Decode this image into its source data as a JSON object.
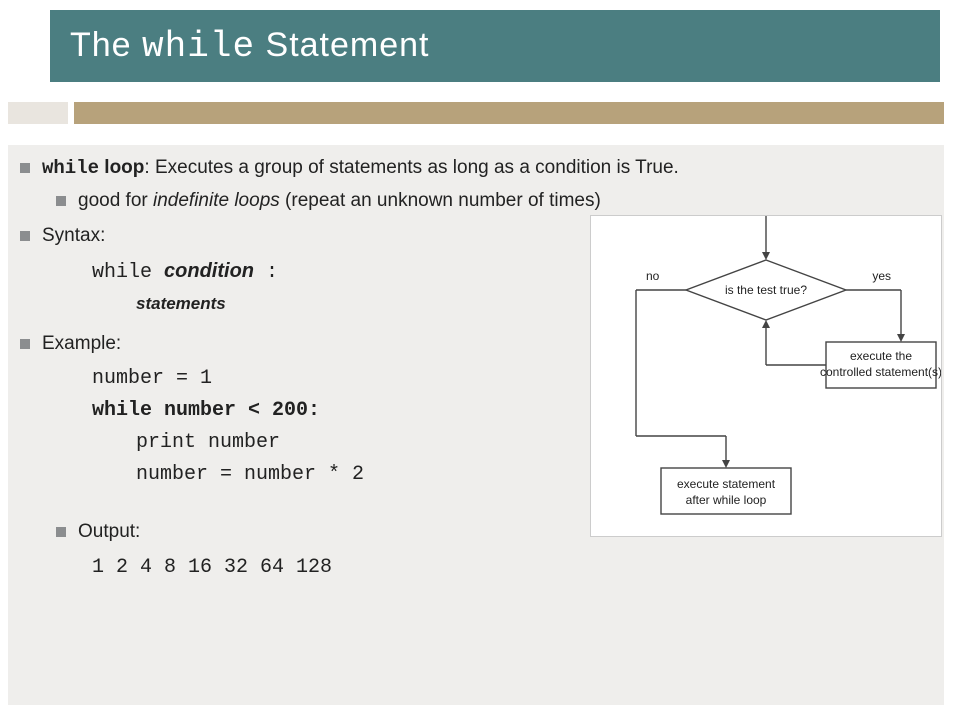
{
  "header": {
    "title_pre": "The ",
    "title_code": "while",
    "title_post": " Statement"
  },
  "bullets": {
    "def_code": "while",
    "def_label": " loop",
    "def_rest": ": Executes a group of statements as long as a condition is True.",
    "def_sub_pre": "good for ",
    "def_sub_italic": "indefinite loops",
    "def_sub_post": " (repeat an unknown number of times)",
    "syntax_label": "Syntax:",
    "syntax_code_kw": "while ",
    "syntax_code_cond": "condition",
    "syntax_code_colon": " :",
    "syntax_stmts": "statements",
    "example_label": "Example:",
    "example_code": {
      "line1": "number = 1",
      "line2": "while number < 200:",
      "line3": "print number",
      "line4": "number = number * 2"
    },
    "output_label": "Output:",
    "output_value": "1 2 4 8 16 32 64 128"
  },
  "flowchart": {
    "diamond": "is the test true?",
    "no": "no",
    "yes": "yes",
    "box_exec1": "execute the",
    "box_exec2": "controlled statement(s)",
    "box_after1": "execute statement",
    "box_after2": "after while loop"
  }
}
